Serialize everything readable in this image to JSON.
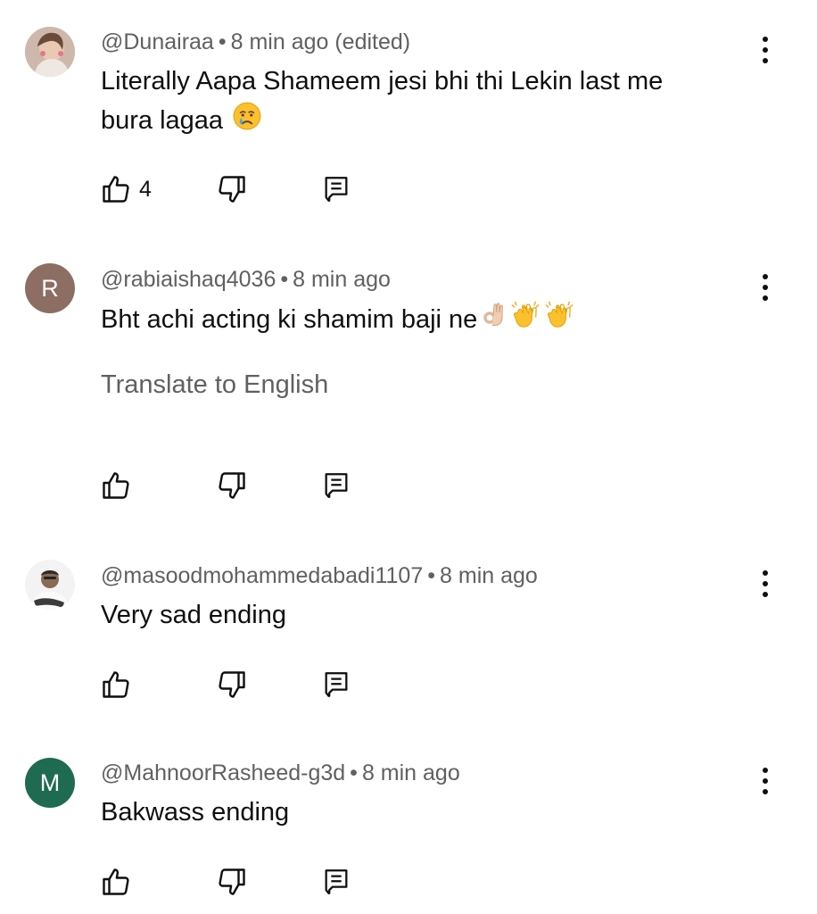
{
  "comments": [
    {
      "handle": "@Dunairaa",
      "time": "8 min ago (edited)",
      "text_lines": [
        "Literally Aapa Shameem jesi bhi thi Lekin last me",
        "bura lagaa"
      ],
      "emojis": [
        "crying-face-emoji"
      ],
      "likes": "4",
      "avatar_type": "photo"
    },
    {
      "handle": "@rabiaishaq4036",
      "time": "8 min ago",
      "text": "Bht achi acting ki shamim baji ne",
      "emojis": [
        "ok-hand-emoji",
        "clapping-hands-emoji",
        "clapping-hands-emoji"
      ],
      "translate": "Translate to English",
      "avatar_letter": "R",
      "avatar_color": "#8d6e63"
    },
    {
      "handle": "@masoodmohammedabadi1107",
      "time": "8 min ago",
      "text": "Very sad ending",
      "avatar_type": "photo"
    },
    {
      "handle": "@MahnoorRasheed-g3d",
      "time": "8 min ago",
      "text": "Bakwass ending",
      "avatar_letter": "M",
      "avatar_color": "#1e6b52"
    }
  ],
  "separator": "•",
  "icons": {
    "like": "thumb-up-icon",
    "dislike": "thumb-down-icon",
    "reply": "reply-icon",
    "more": "more-vert-icon"
  }
}
